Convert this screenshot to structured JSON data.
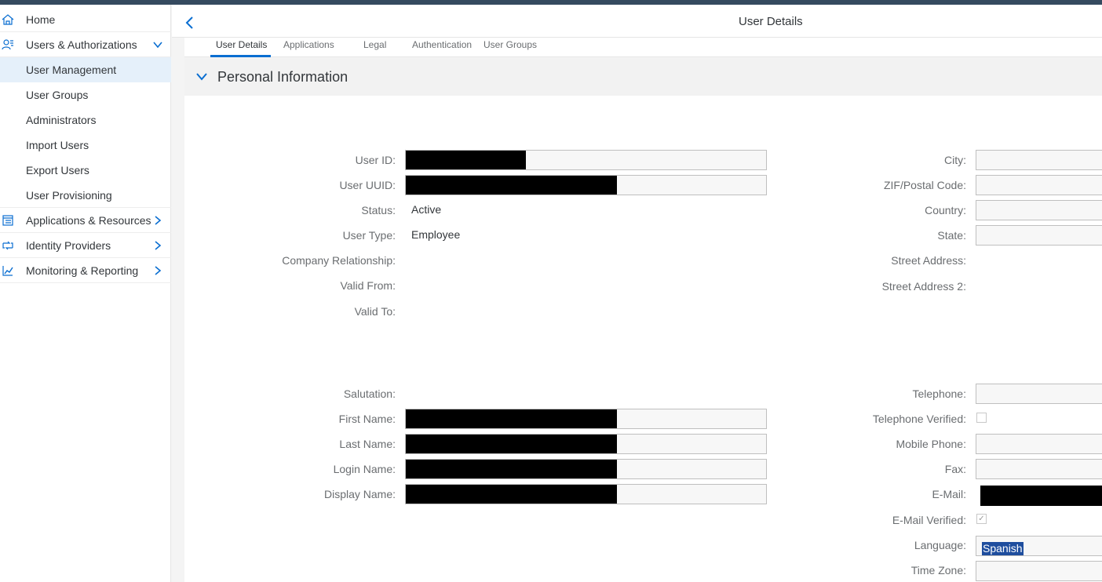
{
  "sidebar": {
    "items": [
      {
        "label": "Home",
        "icon": "home-icon"
      },
      {
        "label": "Users & Authorizations",
        "icon": "users-icon"
      },
      {
        "label": "User Management"
      },
      {
        "label": "User Groups"
      },
      {
        "label": "Administrators"
      },
      {
        "label": "Import Users"
      },
      {
        "label": "Export Users"
      },
      {
        "label": "User Provisioning"
      },
      {
        "label": "Applications & Resources",
        "icon": "applications-icon"
      },
      {
        "label": "Identity Providers",
        "icon": "identity-providers-icon"
      },
      {
        "label": "Monitoring & Reporting",
        "icon": "monitoring-icon"
      }
    ],
    "selected": "User Management"
  },
  "header": {
    "title": "User Details"
  },
  "tabs": [
    "User Details",
    "Applications",
    "Legal",
    "Authentication",
    "User Groups"
  ],
  "active_tab": "User Details",
  "section": {
    "title": "Personal Information"
  },
  "left_fields": {
    "user_id": "User ID:",
    "user_uuid": "User UUID:",
    "status": "Status:",
    "status_value": "Active",
    "user_type": "User Type:",
    "user_type_value": "Employee",
    "company_relationship": "Company Relationship:",
    "valid_from": "Valid From:",
    "valid_to": "Valid To:",
    "salutation": "Salutation:",
    "first_name": "First Name:",
    "last_name": "Last Name:",
    "login_name": "Login Name:",
    "display_name": "Display Name:"
  },
  "right_fields": {
    "city": "City:",
    "zip": "ZIF/Postal Code:",
    "country": "Country:",
    "state": "State:",
    "street_address": "Street Address:",
    "street_address_2": "Street Address 2:",
    "telephone": "Telephone:",
    "telephone_verified": "Telephone Verified:",
    "mobile_phone": "Mobile Phone:",
    "fax": "Fax:",
    "email": "E-Mail:",
    "email_verified": "E-Mail Verified:",
    "language": "Language:",
    "language_value": "Spanish",
    "time_zone": "Time Zone:"
  },
  "colors": {
    "accent": "#0a6ed1",
    "shell": "#354a5f",
    "selected_bg": "#e5f0fa",
    "redaction": "#000000"
  }
}
